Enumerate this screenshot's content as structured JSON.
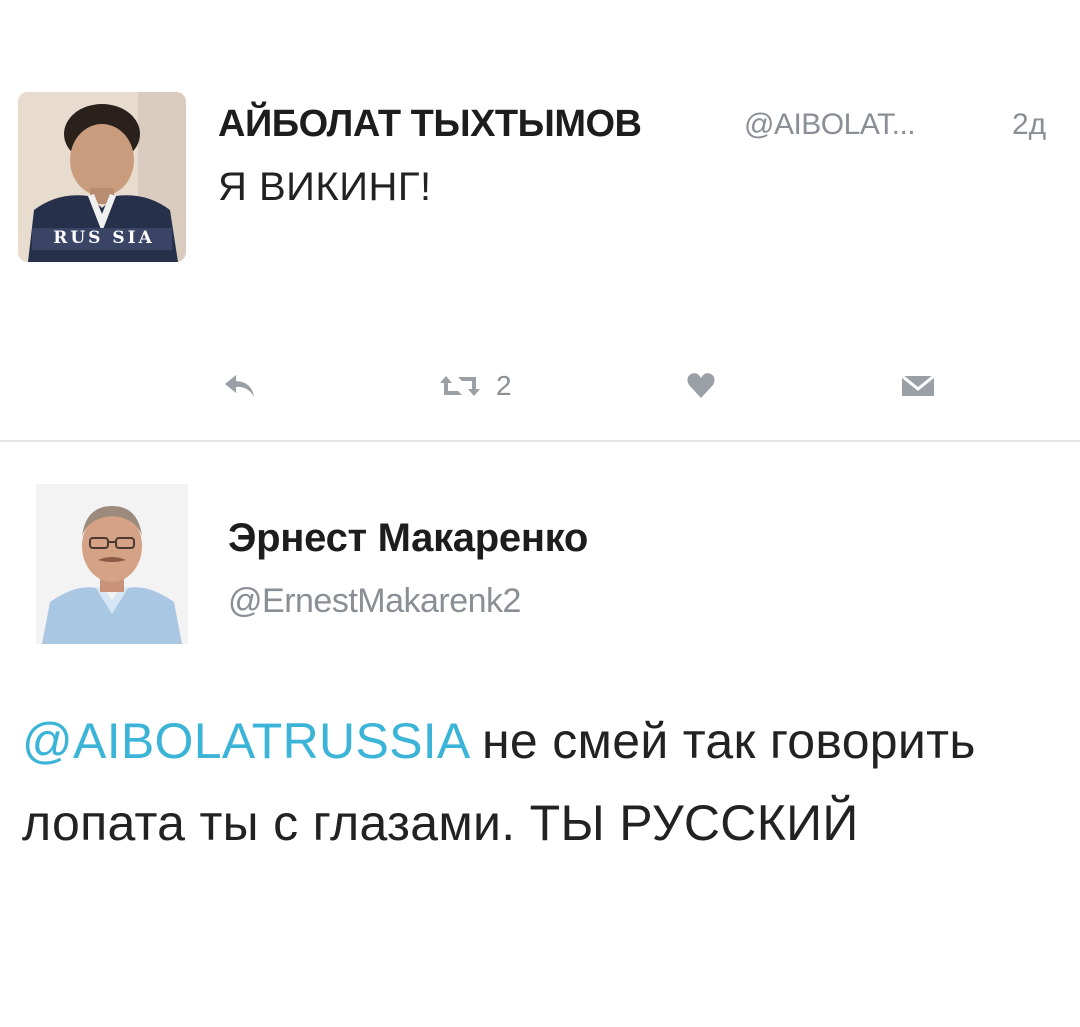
{
  "tweet1": {
    "author_name": "АЙБОЛАТ ТЫХТЫМОВ",
    "handle": "@AIBOLAT...",
    "time": "2д",
    "text": "Я ВИКИНГ!",
    "avatar_jacket_text": "RUS SIA",
    "actions": {
      "reply_icon": "reply-icon",
      "retweet_icon": "retweet-icon",
      "retweet_count": "2",
      "like_icon": "heart-icon",
      "dm_icon": "envelope-icon"
    }
  },
  "tweet2": {
    "author_name": "Эрнест Макаренко",
    "handle": "@ErnestMakarenk2",
    "mention": "@AIBOLATRUSSIA",
    "text": " не смей так говорить лопата ты с глазами.  ТЫ РУССКИЙ"
  },
  "colors": {
    "mention": "#3bb4d8",
    "muted": "#8a8f95",
    "text": "#222222",
    "divider": "#e3e5e8"
  }
}
